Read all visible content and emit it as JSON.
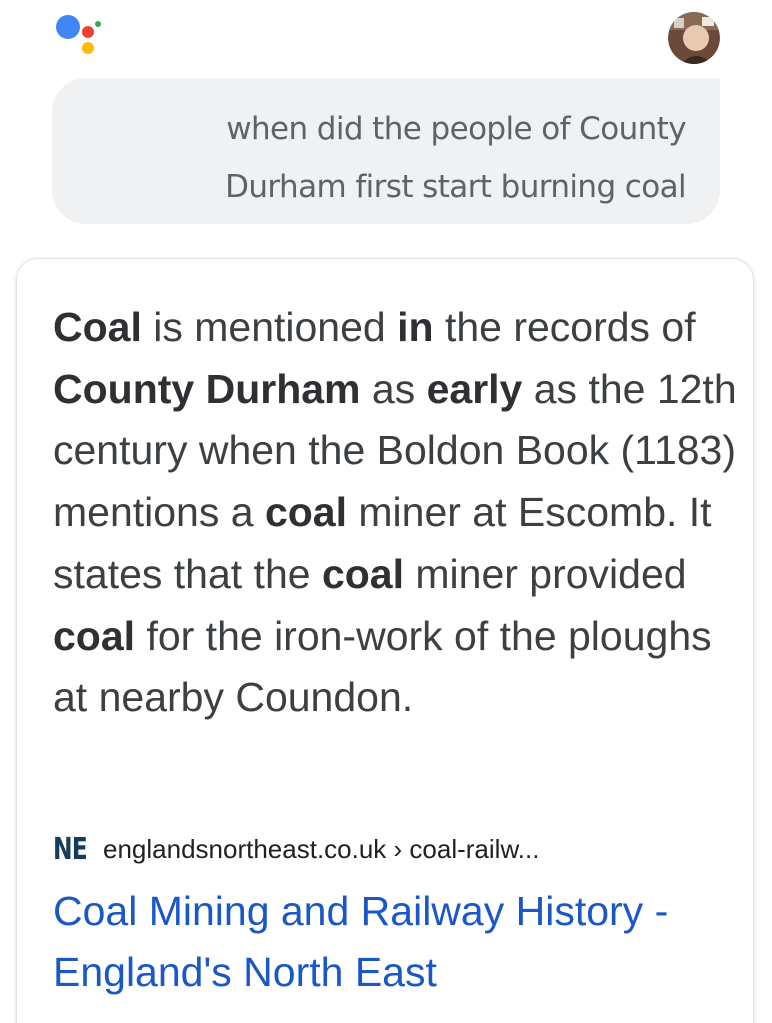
{
  "assistant": {
    "logo_icon": "google-assistant-dots-icon",
    "dot_colors": {
      "blue": "#4285F4",
      "red": "#EA4335",
      "yellow": "#FBBC05",
      "green": "#34A853"
    }
  },
  "user": {
    "avatar_icon": "user-avatar-photo"
  },
  "query": {
    "text": "when did the people of County Durham first start burning coal"
  },
  "answer": {
    "snippet_segments": [
      {
        "text": "Coal",
        "bold": true
      },
      {
        "text": " is mentioned ",
        "bold": false
      },
      {
        "text": "in",
        "bold": true
      },
      {
        "text": " the records of ",
        "bold": false
      },
      {
        "text": "County Durham",
        "bold": true
      },
      {
        "text": " as ",
        "bold": false
      },
      {
        "text": "early",
        "bold": true
      },
      {
        "text": " as the 12th century when the Boldon Book (1183) mentions a ",
        "bold": false
      },
      {
        "text": "coal",
        "bold": true
      },
      {
        "text": " miner at Escomb. It states that the ",
        "bold": false
      },
      {
        "text": "coal",
        "bold": true
      },
      {
        "text": " miner provided ",
        "bold": false
      },
      {
        "text": "coal",
        "bold": true
      },
      {
        "text": " for the iron-work of the ploughs at nearby Coundon.",
        "bold": false
      }
    ],
    "source": {
      "favicon_text": "NE",
      "breadcrumb": "englandsnortheast.co.uk › coal-railw..."
    },
    "title": "Coal Mining and Railway History - England's North East",
    "colors": {
      "link": "#1a58c8",
      "text": "#3c4043"
    }
  }
}
